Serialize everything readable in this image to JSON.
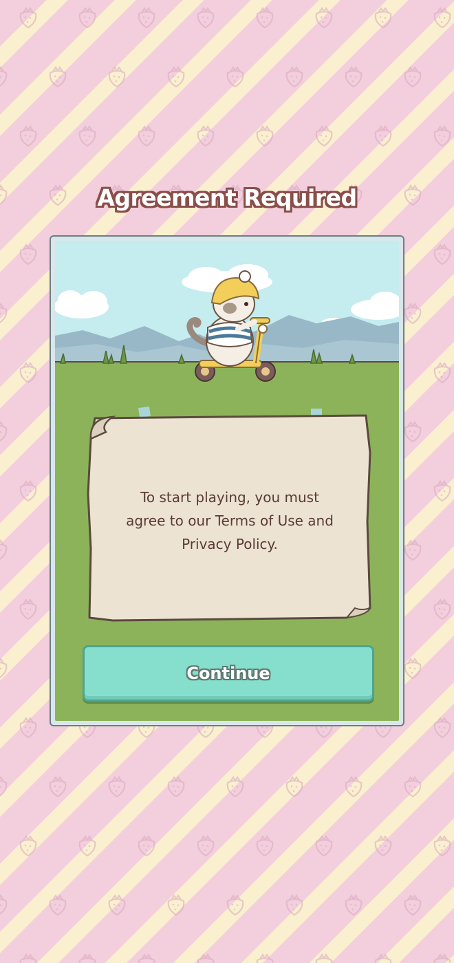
{
  "dialog": {
    "title": "Agreement Required",
    "message_lines": [
      "To start playing, you must",
      "agree to our Terms of Use and",
      "Privacy Policy."
    ],
    "continue_label": "Continue"
  },
  "scene": {
    "character": "cat-on-scooter",
    "character_hat": "yellow-helmet"
  },
  "background": {
    "pattern": "diagonal-stripes-with-strawberries",
    "stripe_colors": [
      "#f3cfdd",
      "#faf0cf"
    ]
  },
  "colors": {
    "button": "#86dfcc",
    "grass": "#8db35a",
    "sky": "#c5ecef",
    "paper": "#ece3d3",
    "text": "#5a3a36"
  }
}
